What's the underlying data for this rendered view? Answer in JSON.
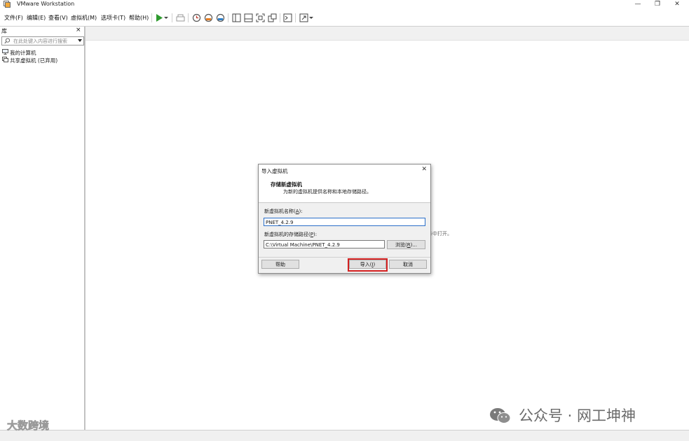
{
  "window": {
    "title": "VMware Workstation",
    "controls": [
      "—",
      "❐",
      "✕"
    ]
  },
  "menu": {
    "items": [
      "文件(F)",
      "编辑(E)",
      "查看(V)",
      "虚拟机(M)",
      "选项卡(T)",
      "帮助(H)"
    ]
  },
  "toolbar": {
    "icons": [
      "play-icon",
      "dropdown-arrow-icon",
      "send-keys-icon",
      "snapshot-icon",
      "revert-snapshot-icon",
      "manage-snapshots-icon",
      "library-view-icon",
      "thumbnail-bar-icon",
      "fit-guest-icon",
      "unity-icon",
      "console-icon",
      "full-screen-icon"
    ],
    "play_color": "#2e9a2e"
  },
  "sidebar": {
    "title": "库",
    "close": "×",
    "search_placeholder": "在此处键入内容进行搜索",
    "items": [
      {
        "label": "我的计算机",
        "icon": "computer-icon"
      },
      {
        "label": "共享虚拟机 (已弃用)",
        "icon": "shared-vm-icon"
      }
    ]
  },
  "main": {
    "background_text": "卡中打开。"
  },
  "dialog": {
    "title": "导入虚拟机",
    "close": "✕",
    "heading": "存储新虚拟机",
    "description": "为新的虚拟机提供名称和本地存储路径。",
    "name_label": "新虚拟机名称(",
    "name_key": "A",
    "name_suffix": "):",
    "name_value": "PNET_4.2.9",
    "path_label": "新虚拟机的存储路径(",
    "path_key": "P",
    "path_suffix": "):",
    "path_value": "C:\\Virtual Machine\\PNET_4.2.9",
    "browse_label": "浏览(",
    "browse_key": "R",
    "browse_suffix": ")...",
    "help_label": "帮助",
    "import_label": "导入(",
    "import_key": "I",
    "import_suffix": ")",
    "cancel_label": "取消",
    "highlight_color": "#d42020"
  },
  "watermarks": {
    "left": "大数跨境",
    "right": "公众号 · 网工坤神"
  }
}
